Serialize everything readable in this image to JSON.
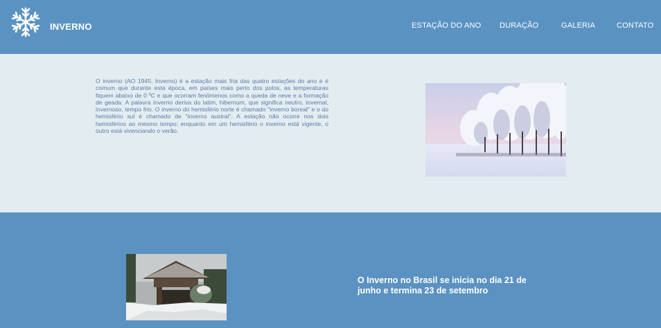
{
  "header": {
    "brand": "INVERNO",
    "logo_icon": "snowflake-icon",
    "nav": [
      "ESTAÇÃO DO ANO",
      "DURAÇÃO",
      "GALERIA",
      "CONTATO"
    ]
  },
  "intro": {
    "text": "O inverno (AO 1945: Inverno) é a estação mais fria das quatro estações do ano e é comum que durante esta época, em países mais perto dos polos, as temperaturas fiquem abaixo de 0 ºC e que ocorram fenômenos como a queda de neve e a formação de geada. A palavra inverno deriva do latim, hibernum, que significa neutro, invernal, invernoso, tempo frio. O inverno do hemisfério norte é chamado \"inverno boreal\" e o do hemisfério sul é chamado de \"inverno austral\". A estação não ocorre nos dois hemisférios ao mesmo tempo: enquanto em um hemisfério o inverno está vigente, o outro está vivenciando o verão."
  },
  "brasil": {
    "text": "O Inverno no Brasil se inicia no dia 21 de junho e termina 23 de setembro"
  },
  "colors": {
    "header_bg": "#5a93c2",
    "section_light_bg": "#e3edf1",
    "text_blue": "#5b78a6",
    "white": "#ffffff"
  }
}
